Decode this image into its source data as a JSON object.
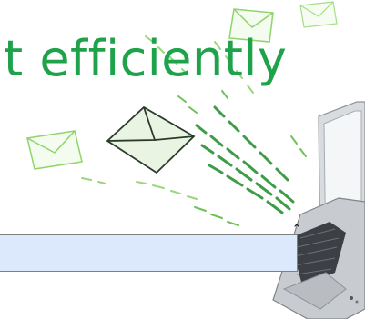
{
  "slide": {
    "headline": "t efficiently",
    "textbox": {
      "value": ""
    }
  },
  "icons": {
    "illustration": "emails-to-laptop-illustration",
    "rotate_handle": "rotate-handle-icon"
  },
  "colors": {
    "headline": "#1ea34b",
    "textbox_fill": "#dce8fb",
    "textbox_border": "#7f7f7f",
    "envelope_green": "#8fd46a",
    "stream_green": "#2e8b3c"
  }
}
